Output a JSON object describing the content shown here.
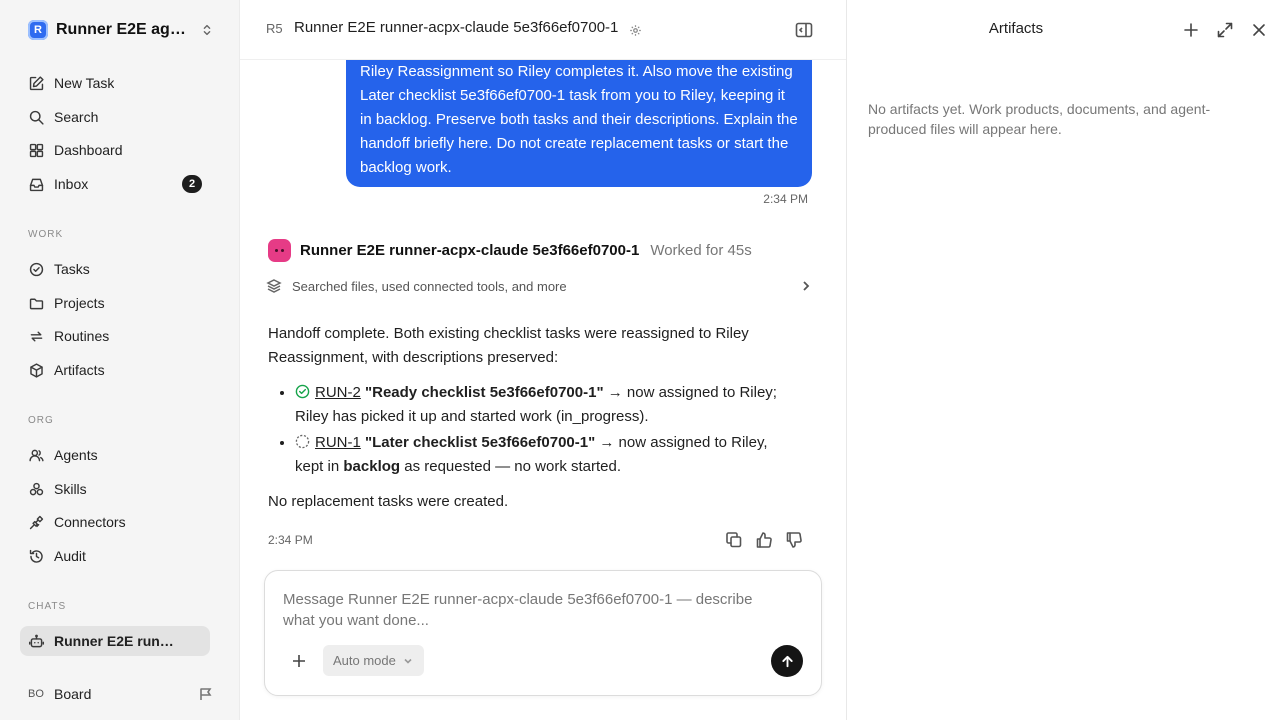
{
  "sidebar": {
    "workspace": {
      "logo": "R",
      "name": "Runner E2E agen..."
    },
    "primary": [
      {
        "label": "New Task",
        "icon": "edit-icon"
      },
      {
        "label": "Search",
        "icon": "search-icon"
      },
      {
        "label": "Dashboard",
        "icon": "dashboard-icon"
      },
      {
        "label": "Inbox",
        "icon": "inbox-icon",
        "badge": "2"
      }
    ],
    "work_label": "WORK",
    "work": [
      {
        "label": "Tasks",
        "icon": "check-circle-icon"
      },
      {
        "label": "Projects",
        "icon": "folder-icon"
      },
      {
        "label": "Routines",
        "icon": "repeat-icon"
      },
      {
        "label": "Artifacts",
        "icon": "cube-icon"
      }
    ],
    "org_label": "ORG",
    "org": [
      {
        "label": "Agents",
        "icon": "users-icon"
      },
      {
        "label": "Skills",
        "icon": "skills-icon"
      },
      {
        "label": "Connectors",
        "icon": "plug-icon"
      },
      {
        "label": "Audit",
        "icon": "history-icon"
      }
    ],
    "chats_label": "CHATS",
    "chats": [
      {
        "label": "Runner E2E runn...",
        "icon": "bot-icon"
      }
    ],
    "board": {
      "avatar": "BO",
      "label": "Board"
    }
  },
  "header": {
    "initials": "R5",
    "title": "Runner E2E runner-acpx-claude 5e3f66ef0700-1"
  },
  "user_message": {
    "text": "Riley Reassignment so Riley completes it. Also move the existing Later checklist 5e3f66ef0700-1 task from you to Riley, keeping it in backlog. Preserve both tasks and their descriptions. Explain the handoff briefly here. Do not create replacement tasks or start the backlog work.",
    "time": "2:34 PM"
  },
  "agent_message": {
    "name": "Runner E2E runner-acpx-claude 5e3f66ef0700-1",
    "worked": "Worked for 45s",
    "tools_summary": "Searched files, used connected tools, and more",
    "intro": "Handoff complete. Both existing checklist tasks were reassigned to Riley Reassignment, with descriptions preserved:",
    "items": [
      {
        "id": "RUN-2",
        "title": "\"Ready checklist 5e3f66ef0700-1\"",
        "text_a": " → now assigned to Riley; Riley has picked it up and started work (in_progress).",
        "status": "done"
      },
      {
        "id": "RUN-1",
        "title": "\"Later checklist 5e3f66ef0700-1\"",
        "text_a": " → now assigned to Riley, kept in ",
        "bold": "backlog",
        "text_b": " as requested — no work started.",
        "status": "backlog"
      }
    ],
    "outro": "No replacement tasks were created.",
    "time": "2:34 PM"
  },
  "composer": {
    "placeholder": "Message Runner E2E runner-acpx-claude 5e3f66ef0700-1 — describe what you want done...",
    "value": "",
    "mode": "Auto mode"
  },
  "artifacts": {
    "title": "Artifacts",
    "empty": "No artifacts yet. Work products, documents, and agent-produced files will appear here."
  },
  "colors": {
    "accent": "#2563eb",
    "agent_avatar": "#e63b86",
    "success": "#16a34a"
  }
}
